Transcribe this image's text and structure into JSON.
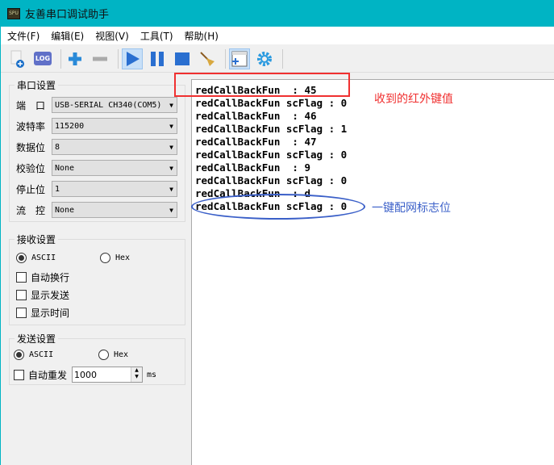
{
  "window": {
    "title": "友善串口调试助手",
    "icon_text": "SPU"
  },
  "menu": [
    "文件(F)",
    "编辑(E)",
    "视图(V)",
    "工具(T)",
    "帮助(H)"
  ],
  "toolbar": {
    "log_label": "LOG"
  },
  "serial": {
    "title": "串口设置",
    "fields": [
      {
        "label": "端　口",
        "value": "USB-SERIAL CH340(COM5)"
      },
      {
        "label": "波特率",
        "value": "115200"
      },
      {
        "label": "数据位",
        "value": "8"
      },
      {
        "label": "校验位",
        "value": "None"
      },
      {
        "label": "停止位",
        "value": "1"
      },
      {
        "label": "流　控",
        "value": "None"
      }
    ]
  },
  "receive": {
    "title": "接收设置",
    "ascii": "ASCII",
    "hex": "Hex",
    "options": [
      "自动换行",
      "显示发送",
      "显示时间"
    ]
  },
  "send": {
    "title": "发送设置",
    "ascii": "ASCII",
    "hex": "Hex",
    "auto_resend": "自动重发",
    "interval": "1000",
    "unit": "ms"
  },
  "output": {
    "text": "redCallBackFun  : 45\nredCallBackFun scFlag : 0\nredCallBackFun  : 46\nredCallBackFun scFlag : 1\nredCallBackFun  : 47\nredCallBackFun scFlag : 0\nredCallBackFun  : 9\nredCallBackFun scFlag : 0\nredCallBackFun  : d\nredCallBackFun scFlag : 0"
  },
  "annotations": {
    "red": "收到的红外键值",
    "blue": "一键配网标志位",
    "red_color": "#f03030",
    "blue_color": "#3a5fc8"
  }
}
